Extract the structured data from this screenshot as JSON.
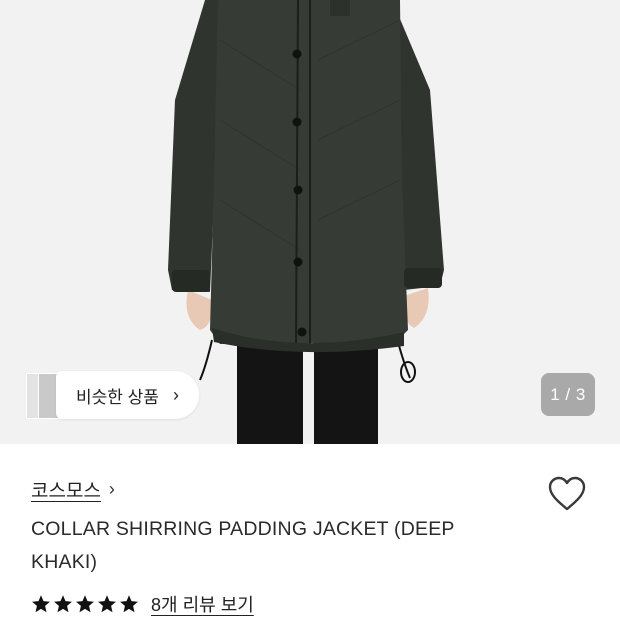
{
  "hero": {
    "similar_label": "비슷한 상품",
    "similar_chevron": "›",
    "counter": "1 / 3"
  },
  "product": {
    "brand": "코스모스",
    "brand_chevron": "›",
    "title": "COLLAR SHIRRING PADDING JACKET (DEEP KHAKI)",
    "rating": 5,
    "reviews_link": "8개 리뷰 보기"
  },
  "icons": {
    "wishlist": "heart-outline-icon",
    "star": "star-filled-icon"
  },
  "colors": {
    "jacket": "#343a33",
    "background": "#f2f2f2",
    "counter_bg": "#6e6e6e"
  }
}
